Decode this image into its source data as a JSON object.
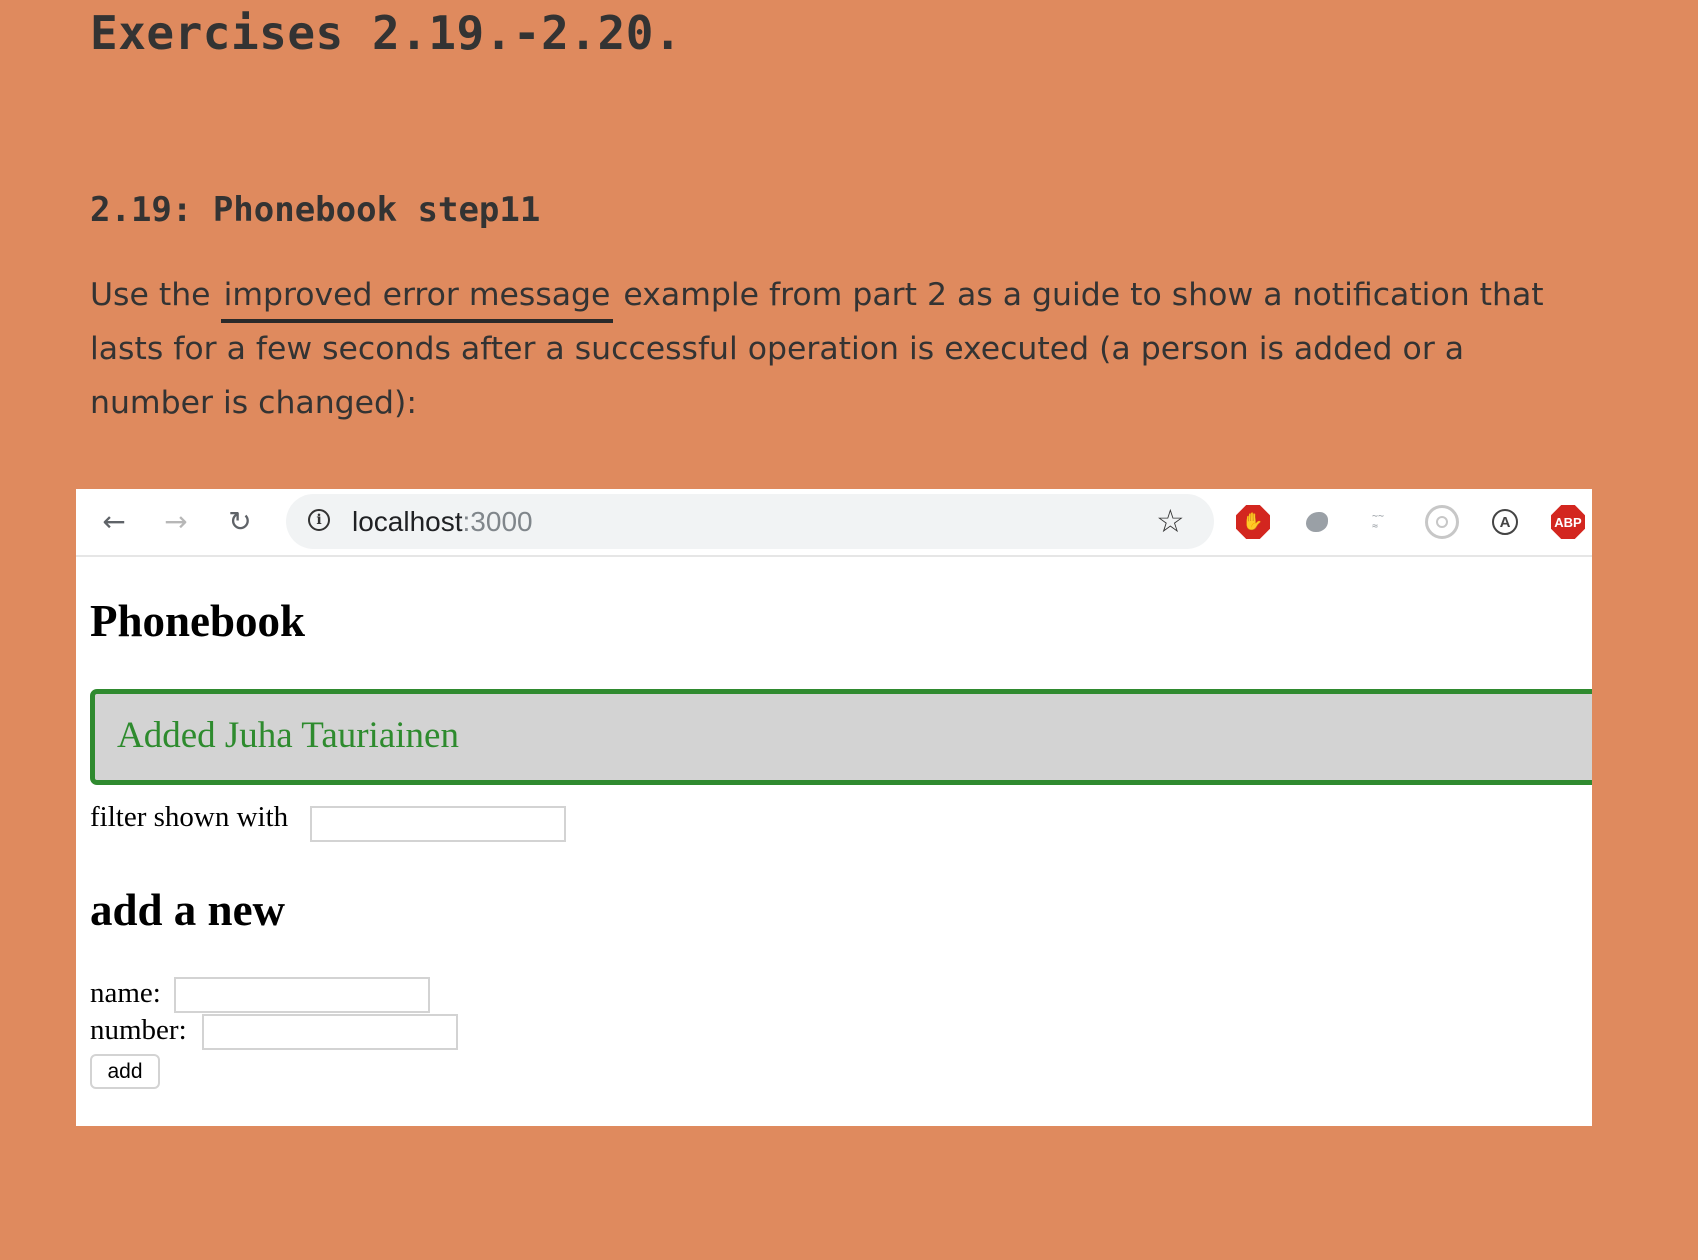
{
  "heading": "Exercises 2.19.-2.20.",
  "subheading": "2.19: Phonebook step11",
  "intro": {
    "before_link": "Use the ",
    "link_text": "improved error message",
    "after_link": " example from part 2 as a guide to show a notification that lasts for a few seconds after a successful operation is executed (a person is added or a number is changed):"
  },
  "browser": {
    "back_icon": "arrow-left-icon",
    "forward_icon": "arrow-right-icon",
    "reload_icon": "reload-icon",
    "url_host": "localhost",
    "url_port": ":3000",
    "extensions": [
      "stop-hand-icon",
      "blob-icon",
      "doodle-icon",
      "target-icon",
      "a-circle-icon",
      "adblock-icon"
    ],
    "ext_a_glyph": "A",
    "ext_abp_label": "ABP"
  },
  "app": {
    "title": "Phonebook",
    "notification": "Added Juha Tauriainen",
    "notification_color": "#2e8b2e",
    "filter_label": "filter shown with",
    "section_title": "add a new",
    "name_label": "name:",
    "number_label": "number:",
    "add_button": "add"
  },
  "colors": {
    "page_background": "#df8a5e",
    "notification_background": "#d3d3d3",
    "notification_border": "#2f8a2f"
  }
}
